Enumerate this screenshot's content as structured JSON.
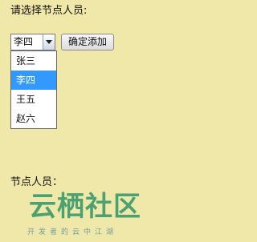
{
  "prompt": "请选择节点人员:",
  "select": {
    "value": "李四"
  },
  "add_button_label": "确定添加",
  "dropdown": {
    "options": [
      "张三",
      "李四",
      "王五",
      "赵六"
    ],
    "selected": "李四"
  },
  "nodes_label": "节点人员：",
  "watermark": {
    "brand": "云栖社区",
    "slogan": "开发者的云中江湖"
  },
  "colors": {
    "background": "#f0e8a8",
    "selection": "#3399ff"
  }
}
